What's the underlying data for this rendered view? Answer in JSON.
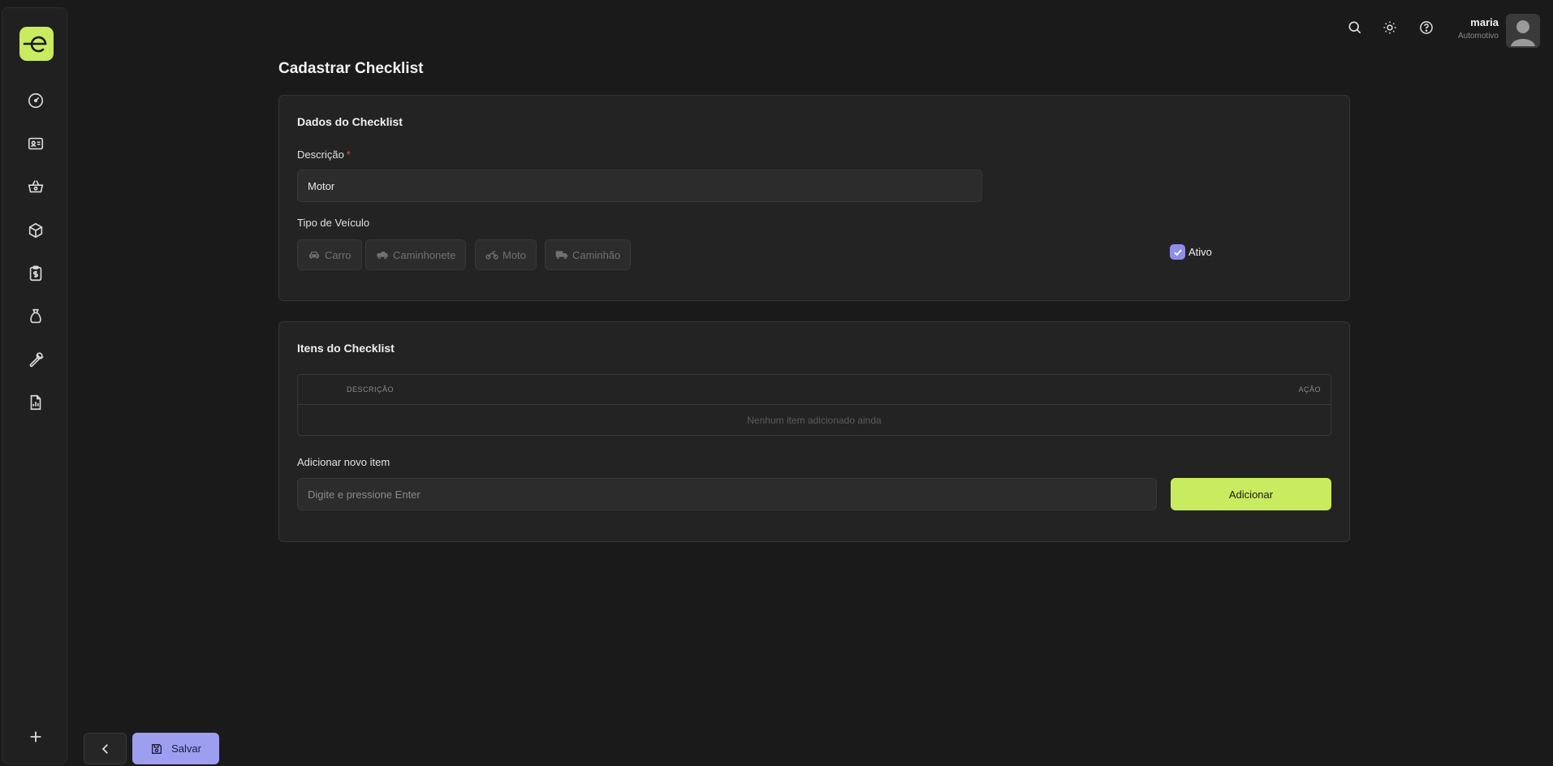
{
  "sidebar": {
    "items": [
      {
        "name": "dashboard-icon"
      },
      {
        "name": "id-card-icon"
      },
      {
        "name": "basket-icon"
      },
      {
        "name": "box-icon"
      },
      {
        "name": "clipboard-dollar-icon"
      },
      {
        "name": "money-bag-icon"
      },
      {
        "name": "wrench-icon"
      },
      {
        "name": "report-icon"
      }
    ],
    "add_icon": "plus-icon"
  },
  "topbar": {
    "user_name": "maria",
    "company": "Automotivo"
  },
  "page": {
    "title": "Cadastrar Checklist"
  },
  "checklist_data": {
    "section_title": "Dados do Checklist",
    "description_label": "Descrição",
    "description_required_mark": "*",
    "description_value": "Motor",
    "vehicle_type_label": "Tipo de Veículo",
    "vehicle_types": [
      {
        "label": "Carro",
        "icon": "car-icon"
      },
      {
        "label": "Caminhonete",
        "icon": "pickup-icon"
      },
      {
        "label": "Moto",
        "icon": "motorcycle-icon"
      },
      {
        "label": "Caminhão",
        "icon": "truck-icon"
      }
    ],
    "active_label": "Ativo",
    "active_checked": true
  },
  "checklist_items": {
    "section_title": "Itens do Checklist",
    "columns": [
      "DESCRIÇÃO",
      "AÇÃO"
    ],
    "empty_text": "Nenhum item adicionado ainda",
    "add_label": "Adicionar novo item",
    "add_placeholder": "Digite e pressione Enter",
    "add_button": "Adicionar"
  },
  "footer": {
    "save_label": "Salvar"
  },
  "colors": {
    "accent_green": "#c8eb5f",
    "accent_purple": "#9d9ef0",
    "background": "#1a1a1a"
  }
}
